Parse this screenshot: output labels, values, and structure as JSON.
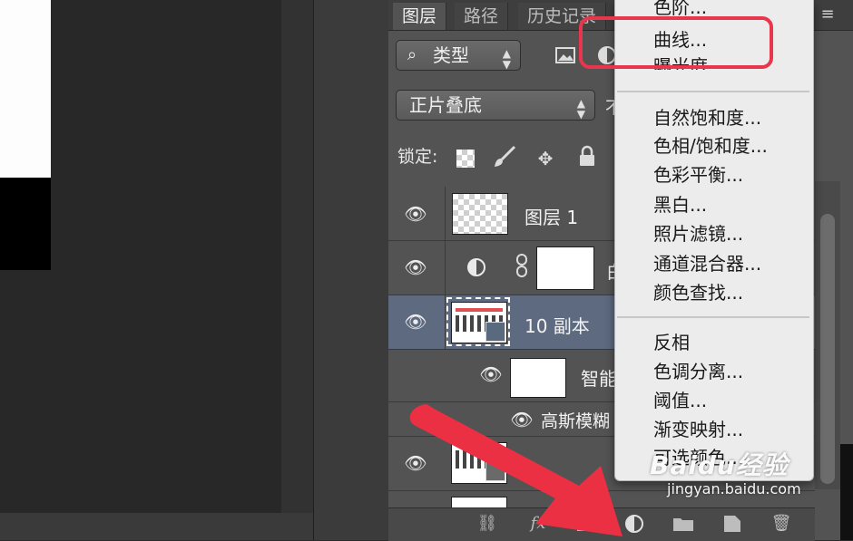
{
  "tabs": [
    "图层",
    "路径",
    "历史记录"
  ],
  "filter": {
    "icon": "search-icon",
    "label": "类型"
  },
  "blend_mode": "正片叠底",
  "opacity_fragment": "不",
  "lock_label": "锁定:",
  "layers": {
    "layer1": {
      "name": "图层 1"
    },
    "adjustment": {
      "name_fragment": "白"
    },
    "copy": {
      "name": "10 副本"
    },
    "smart_filter": {
      "name_fragment": "智能"
    },
    "gaussian": {
      "name_fragment": "高斯模糊"
    }
  },
  "menu": {
    "group1": [
      "色阶...",
      "曲线...",
      "曝光度..."
    ],
    "group2": [
      "自然饱和度...",
      "色相/饱和度...",
      "色彩平衡...",
      "黑白...",
      "照片滤镜...",
      "通道混合器...",
      "颜色查找..."
    ],
    "group3": [
      "反相",
      "色调分离...",
      "阈值...",
      "渐变映射...",
      "可选颜色..."
    ]
  },
  "watermark": {
    "main": "Baidu经验",
    "sub": "jingyan.baidu.com"
  },
  "colors": {
    "highlight": "#e8364c",
    "arrow": "#ec3044",
    "selected_row": "#5d6a80"
  }
}
